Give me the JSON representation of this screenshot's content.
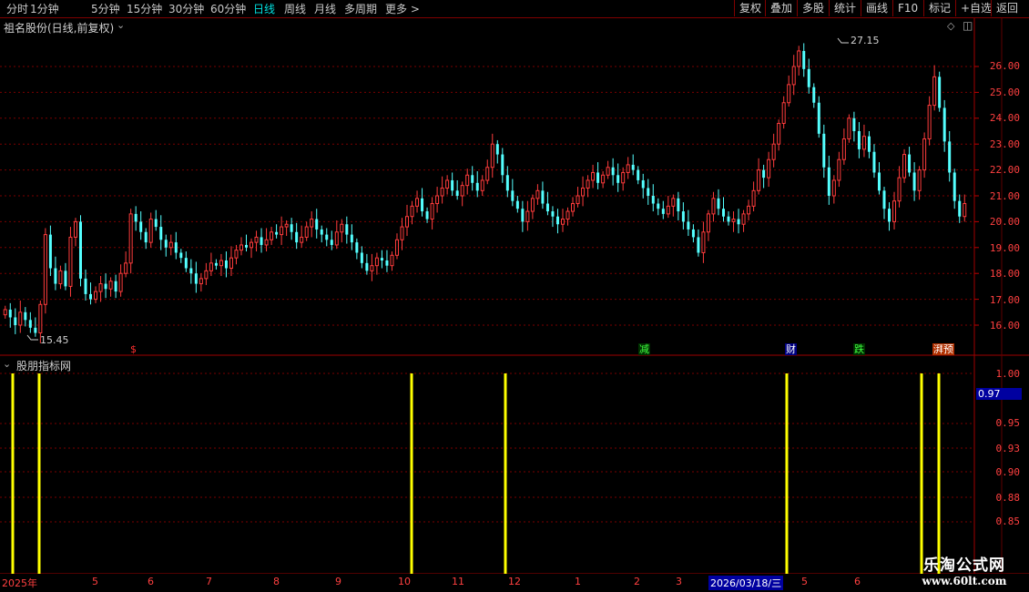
{
  "toolbar": {
    "timeframes": [
      "分时",
      "1分钟",
      "5分钟",
      "15分钟",
      "30分钟",
      "60分钟",
      "日线",
      "周线",
      "月线",
      "多周期",
      "更多 >"
    ],
    "active_timeframe": "日线",
    "buttons": [
      "复权",
      "叠加",
      "多股",
      "统计",
      "画线",
      "F10",
      "标记",
      "+自选",
      "返回"
    ]
  },
  "main_chart": {
    "title": "祖名股份(日线,前复权)",
    "high_annotation": "27.15",
    "low_annotation": "15.45",
    "price_labels": [
      "26.00",
      "25.00",
      "24.00",
      "23.00",
      "22.00",
      "21.00",
      "20.00",
      "19.00",
      "18.00",
      "17.00",
      "16.00"
    ],
    "markers": [
      {
        "text": "$",
        "color": "#ff3030",
        "bg": "none"
      },
      {
        "text": "减",
        "color": "#40ff40",
        "bg": "#003000"
      },
      {
        "text": "财",
        "color": "#ffffff",
        "bg": "#000080"
      },
      {
        "text": "跌",
        "color": "#40ff40",
        "bg": "#003000"
      },
      {
        "text": "湃预",
        "color": "#ffffff",
        "bg": "#b03000"
      }
    ]
  },
  "indicator": {
    "title": "股朋指标网",
    "current_value": "0.97",
    "labels": [
      "1.00",
      "0.95",
      "0.93",
      "0.90",
      "0.88",
      "0.85"
    ]
  },
  "date_axis": {
    "labels": [
      "2025年",
      "5",
      "6",
      "7",
      "8",
      "9",
      "10",
      "11",
      "12",
      "1",
      "2",
      "3",
      "2026/03/18/三",
      "5",
      "6"
    ]
  },
  "watermark": {
    "line1": "乐淘公式网",
    "line2": "www.60lt.com"
  },
  "chart_data": {
    "type": "candlestick",
    "title": "祖名股份(日线,前复权)",
    "ylim": [
      15.3,
      27.3
    ],
    "y_ticks": [
      16,
      17,
      18,
      19,
      20,
      21,
      22,
      23,
      24,
      25,
      26
    ],
    "high": 27.15,
    "low": 15.45,
    "closes": [
      16.6,
      16.3,
      16.0,
      16.5,
      16.2,
      15.9,
      15.7,
      16.8,
      19.5,
      18.2,
      17.6,
      18.1,
      17.5,
      19.4,
      20.0,
      17.8,
      17.2,
      17.0,
      17.3,
      17.6,
      17.4,
      17.7,
      17.3,
      18.0,
      18.4,
      20.3,
      20.0,
      19.6,
      19.2,
      20.1,
      19.8,
      19.3,
      19.0,
      19.2,
      18.8,
      18.6,
      18.2,
      18.0,
      17.6,
      17.8,
      18.1,
      18.4,
      18.3,
      18.5,
      18.2,
      18.6,
      18.9,
      19.1,
      19.0,
      19.2,
      19.4,
      19.1,
      19.3,
      19.6,
      19.5,
      19.8,
      19.9,
      19.6,
      19.2,
      19.4,
      19.8,
      20.1,
      19.7,
      19.5,
      19.3,
      19.1,
      19.6,
      19.9,
      19.5,
      19.2,
      18.8,
      18.4,
      18.1,
      18.3,
      18.6,
      18.5,
      18.3,
      18.7,
      19.3,
      19.8,
      20.2,
      20.6,
      20.9,
      20.4,
      20.1,
      20.7,
      21.0,
      21.3,
      21.6,
      21.2,
      21.0,
      21.4,
      21.8,
      21.5,
      21.2,
      21.6,
      22.1,
      23.0,
      22.6,
      21.8,
      21.2,
      20.8,
      20.5,
      20.0,
      20.4,
      20.9,
      21.2,
      20.7,
      20.4,
      20.2,
      19.9,
      20.1,
      20.4,
      20.7,
      21.0,
      21.3,
      21.6,
      21.9,
      21.5,
      21.8,
      22.1,
      21.8,
      21.5,
      21.9,
      22.2,
      22.0,
      21.6,
      21.3,
      21.0,
      20.7,
      20.5,
      20.3,
      20.6,
      20.9,
      20.4,
      20.0,
      19.7,
      19.4,
      18.8,
      19.6,
      20.3,
      20.9,
      20.5,
      20.2,
      20.0,
      20.1,
      19.9,
      20.3,
      20.6,
      21.2,
      22.0,
      21.7,
      22.4,
      23.0,
      23.8,
      24.6,
      25.3,
      26.0,
      26.6,
      25.9,
      25.2,
      24.6,
      23.4,
      22.1,
      21.0,
      21.6,
      22.4,
      23.2,
      24.0,
      23.5,
      22.8,
      23.3,
      22.7,
      21.9,
      21.2,
      20.5,
      20.0,
      20.8,
      21.7,
      22.6,
      21.9,
      21.2,
      22.0,
      23.2,
      24.5,
      25.6,
      24.4,
      23.1,
      21.9,
      20.8,
      20.2,
      20.7
    ]
  }
}
